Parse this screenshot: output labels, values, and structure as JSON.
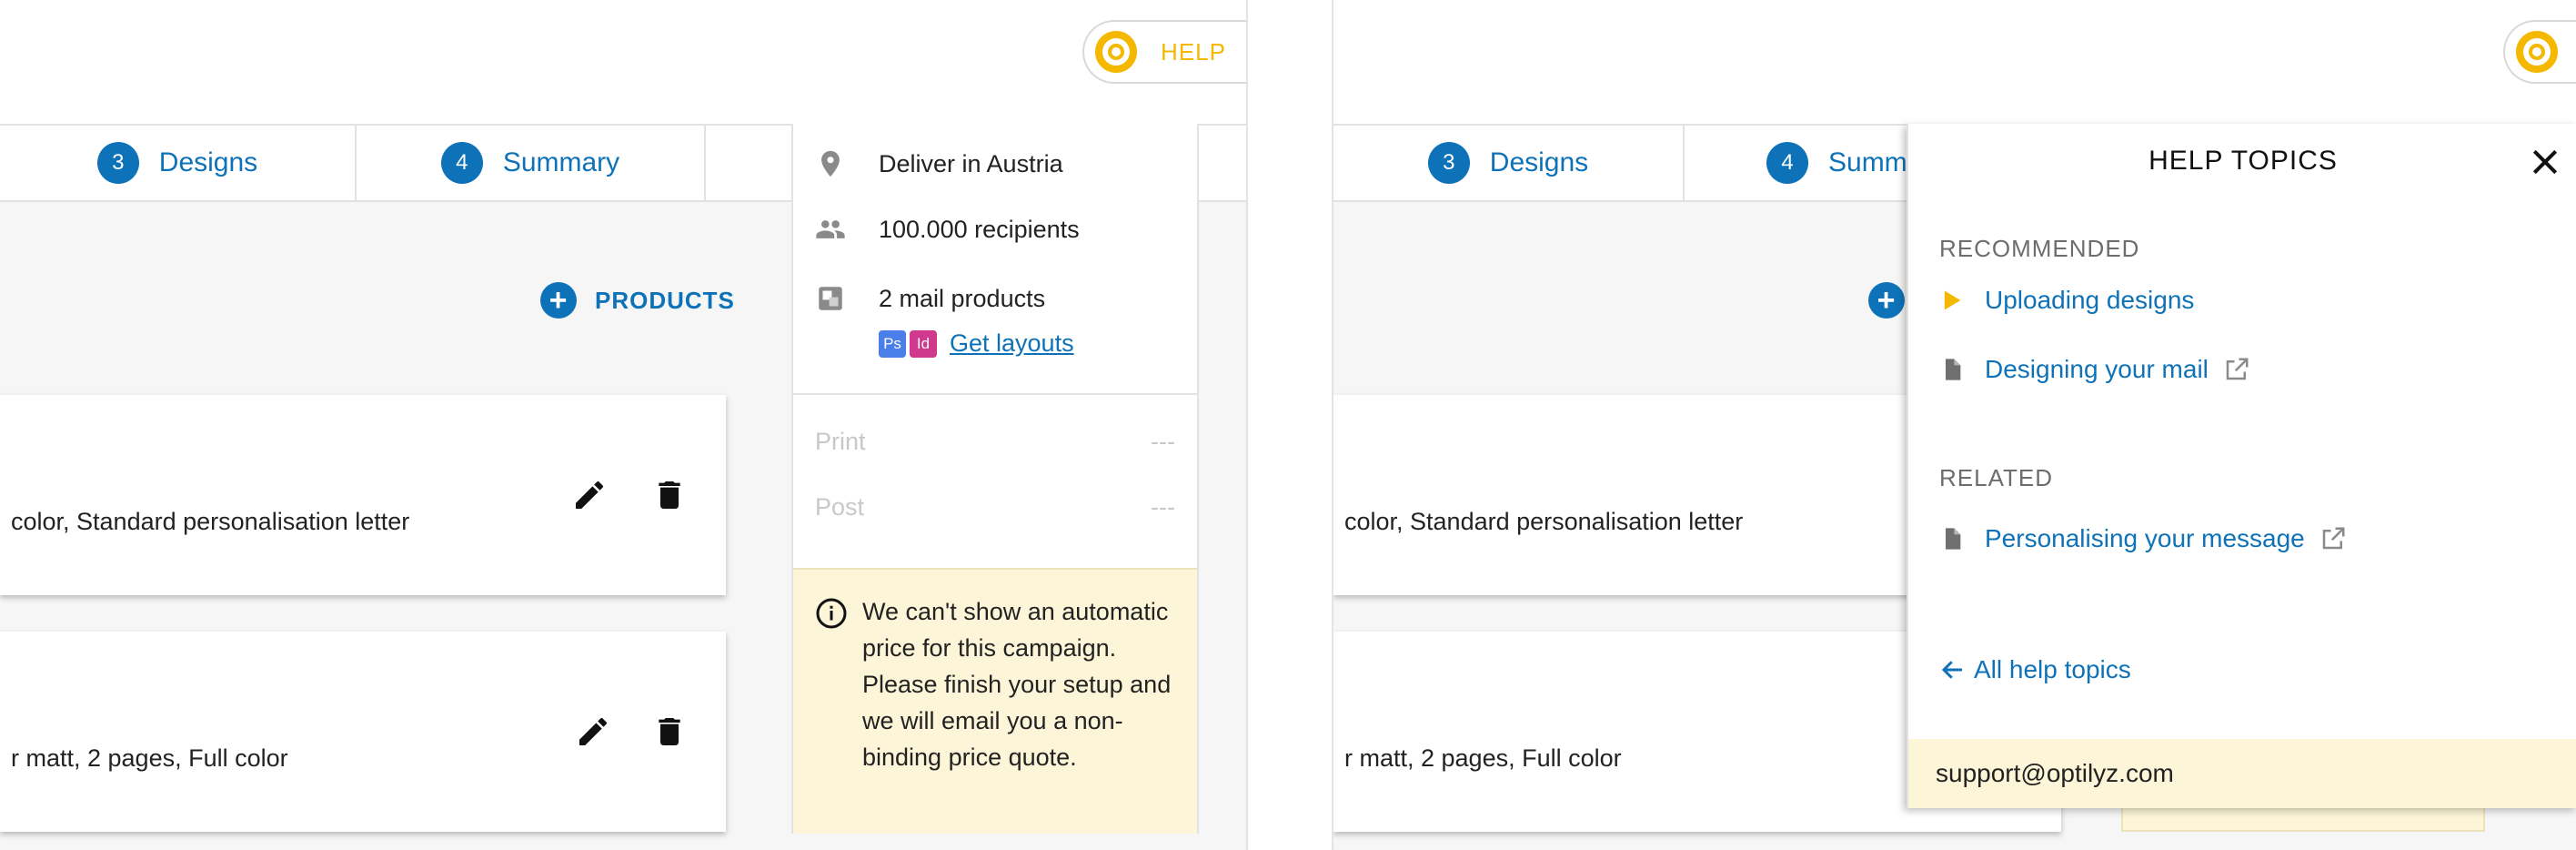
{
  "help": {
    "label": "HELP"
  },
  "steps": [
    {
      "num": "3",
      "label": "Designs"
    },
    {
      "num": "4",
      "label": "Summary"
    }
  ],
  "right_steps": [
    {
      "num": "3",
      "label": "Designs"
    },
    {
      "num": "4",
      "label": "Summ"
    }
  ],
  "add_products": {
    "label": "PRODUCTS"
  },
  "cards": [
    {
      "desc": "color, Standard personalisation letter"
    },
    {
      "desc": "r matt, 2 pages, Full color"
    }
  ],
  "summary": {
    "location": "Deliver in Austria",
    "recipients": "100.000 recipients",
    "products": "2 mail products",
    "badges": [
      {
        "text": "Ps",
        "color": "#4a7ee8"
      },
      {
        "text": "Id",
        "color": "#d1398e"
      }
    ],
    "layouts_link": "Get layouts",
    "print_label": "Print",
    "print_value": "---",
    "post_label": "Post",
    "post_value": "---",
    "notice": "We can't show an automatic price for this campaign. Please finish your setup and we will email you a non-binding price quote."
  },
  "drawer": {
    "title": "HELP TOPICS",
    "recommended_label": "RECOMMENDED",
    "recommended": [
      {
        "label": "Uploading designs",
        "icon": "play-icon",
        "external": false
      },
      {
        "label": "Designing your mail",
        "icon": "document-icon",
        "external": true
      }
    ],
    "related_label": "RELATED",
    "related": [
      {
        "label": "Personalising your message",
        "icon": "document-icon",
        "external": true
      }
    ],
    "back_label": "All help topics",
    "support_email": "support@optilyz.com"
  },
  "colors": {
    "brand_blue": "#0e72b8",
    "help_yellow": "#f5b800",
    "notice_bg": "#fdf5d8"
  }
}
